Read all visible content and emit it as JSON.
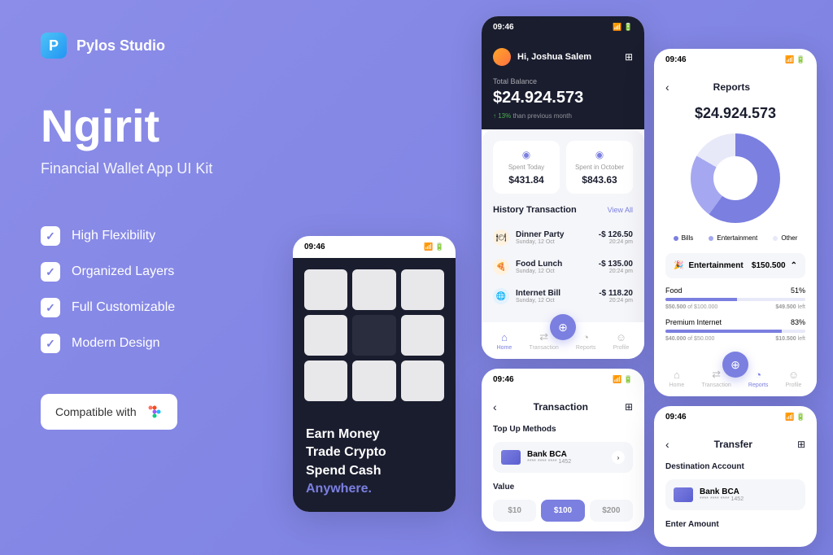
{
  "brand": {
    "name": "Pylos Studio",
    "logo_letter": "P"
  },
  "product": {
    "title": "Ngirit",
    "subtitle": "Financial Wallet App UI Kit"
  },
  "features": [
    "High Flexibility",
    "Organized Layers",
    "Full Customizable",
    "Modern Design"
  ],
  "compat": {
    "label": "Compatible with"
  },
  "status_time": "09:46",
  "phone_home": {
    "greeting": "Hi, Joshua Salem",
    "balance_label": "Total Balance",
    "balance": "$24.924.573",
    "change_pct": "↑ 13%",
    "change_text": "than previous month",
    "spent_today": {
      "label": "Spent Today",
      "value": "$431.84"
    },
    "spent_month": {
      "label": "Spent in October",
      "value": "$843.63"
    },
    "history_title": "History Transaction",
    "view_all": "View All",
    "tx": [
      {
        "name": "Dinner Party",
        "date": "Sunday, 12 Oct",
        "amount": "-$ 126.50",
        "time": "20:24 pm"
      },
      {
        "name": "Food Lunch",
        "date": "Sunday, 12 Oct",
        "amount": "-$ 135.00",
        "time": "20:24 pm"
      },
      {
        "name": "Internet Bill",
        "date": "Sunday, 12 Oct",
        "amount": "-$ 118.20",
        "time": "20:24 pm"
      }
    ],
    "nav": [
      "Home",
      "Transaction",
      "Reports",
      "Profile"
    ]
  },
  "phone_reports": {
    "title": "Reports",
    "balance": "$24.924.573",
    "legend": [
      {
        "label": "Bills",
        "color": "#7B7FE0"
      },
      {
        "label": "Entertainment",
        "color": "#A5A8F0"
      },
      {
        "label": "Other",
        "color": "#E8E9F8"
      }
    ],
    "category": {
      "name": "Entertainment",
      "value": "$150.500"
    },
    "budgets": [
      {
        "name": "Food",
        "pct": "51%",
        "spent": "$50.500",
        "total": "$100.000",
        "left": "$49.500",
        "fill": 51
      },
      {
        "name": "Premium Internet",
        "pct": "83%",
        "spent": "$40.000",
        "total": "$50.000",
        "left": "$10.500",
        "fill": 83
      }
    ]
  },
  "phone_tx": {
    "title": "Transaction",
    "topup_label": "Top Up Methods",
    "bank": {
      "name": "Bank BCA",
      "num": "**** **** **** 1452"
    },
    "value_label": "Value",
    "chips": [
      "$10",
      "$100",
      "$200"
    ]
  },
  "phone_transfer": {
    "title": "Transfer",
    "dest_label": "Destination Account",
    "bank": {
      "name": "Bank BCA",
      "num": "**** **** **** 1452"
    },
    "amount_label": "Enter Amount"
  },
  "promo": {
    "line1": "Earn Money",
    "line2": "Trade Crypto",
    "line3": "Spend Cash",
    "line4": "Anywhere."
  },
  "chart_data": {
    "type": "pie",
    "title": "Reports",
    "series": [
      {
        "name": "Bills",
        "value": 60,
        "color": "#7B7FE0"
      },
      {
        "name": "Entertainment",
        "value": 23,
        "color": "#A5A8F0"
      },
      {
        "name": "Other",
        "value": 17,
        "color": "#E8E9F8"
      }
    ]
  }
}
